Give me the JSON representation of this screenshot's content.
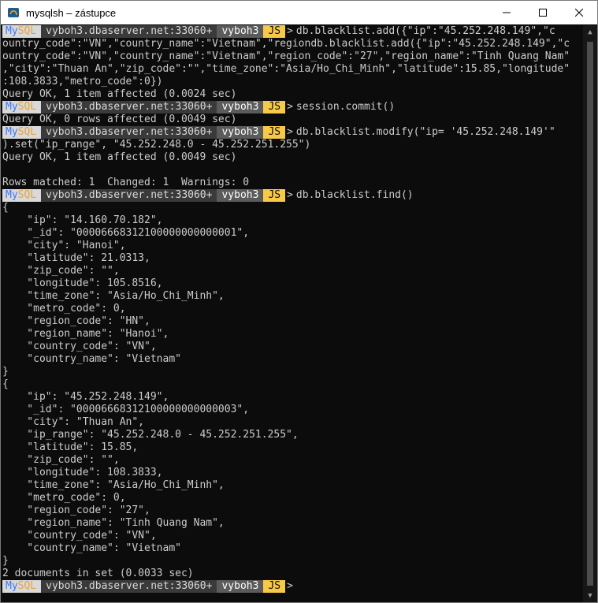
{
  "window": {
    "title": "mysqlsh – zástupce",
    "buttons": {
      "minimize": "—",
      "maximize": "☐",
      "close": "✕"
    }
  },
  "prompt": {
    "my": "My",
    "sql": "SQL",
    "host": "vyboh3.dbaserver.net:33060+",
    "db": "vyboh3",
    "mode": "JS",
    "arrow": ">"
  },
  "terminal": {
    "blocks": [
      {
        "command": "db.blacklist.add({\"ip\":\"45.252.248.149\",\"c",
        "output": [
          "ountry_code\":\"VN\",\"country_name\":\"Vietnam\",\"regiondb.blacklist.add({\"ip\":\"45.252.248.149\",\"c",
          "ountry_code\":\"VN\",\"country_name\":\"Vietnam\",\"region_code\":\"27\",\"region_name\":\"Tinh Quang Nam\"",
          ",\"city\":\"Thuan An\",\"zip_code\":\"\",\"time_zone\":\"Asia/Ho_Chi_Minh\",\"latitude\":15.85,\"longitude\"",
          ":108.3833,\"metro_code\":0})",
          "Query OK, 1 item affected (0.0024 sec)"
        ]
      },
      {
        "command": "session.commit()",
        "output": [
          "Query OK, 0 rows affected (0.0049 sec)"
        ]
      },
      {
        "command": "db.blacklist.modify(\"ip= '45.252.248.149'\"",
        "output": [
          ").set(\"ip_range\", \"45.252.248.0 - 45.252.251.255\")",
          "Query OK, 1 item affected (0.0049 sec)",
          "",
          "Rows matched: 1  Changed: 1  Warnings: 0"
        ]
      },
      {
        "command": "db.blacklist.find()",
        "output": [
          "{",
          "    \"ip\": \"14.160.70.182\",",
          "    \"_id\": \"00006668312100000000000001\",",
          "    \"city\": \"Hanoi\",",
          "    \"latitude\": 21.0313,",
          "    \"zip_code\": \"\",",
          "    \"longitude\": 105.8516,",
          "    \"time_zone\": \"Asia/Ho_Chi_Minh\",",
          "    \"metro_code\": 0,",
          "    \"region_code\": \"HN\",",
          "    \"region_name\": \"Hanoi\",",
          "    \"country_code\": \"VN\",",
          "    \"country_name\": \"Vietnam\"",
          "}",
          "{",
          "    \"ip\": \"45.252.248.149\",",
          "    \"_id\": \"00006668312100000000000003\",",
          "    \"city\": \"Thuan An\",",
          "    \"ip_range\": \"45.252.248.0 - 45.252.251.255\",",
          "    \"latitude\": 15.85,",
          "    \"zip_code\": \"\",",
          "    \"longitude\": 108.3833,",
          "    \"time_zone\": \"Asia/Ho_Chi_Minh\",",
          "    \"metro_code\": 0,",
          "    \"region_code\": \"27\",",
          "    \"region_name\": \"Tinh Quang Nam\",",
          "    \"country_code\": \"VN\",",
          "    \"country_name\": \"Vietnam\"",
          "}",
          "2 documents in set (0.0033 sec)"
        ]
      },
      {
        "command": "",
        "output": []
      }
    ]
  }
}
